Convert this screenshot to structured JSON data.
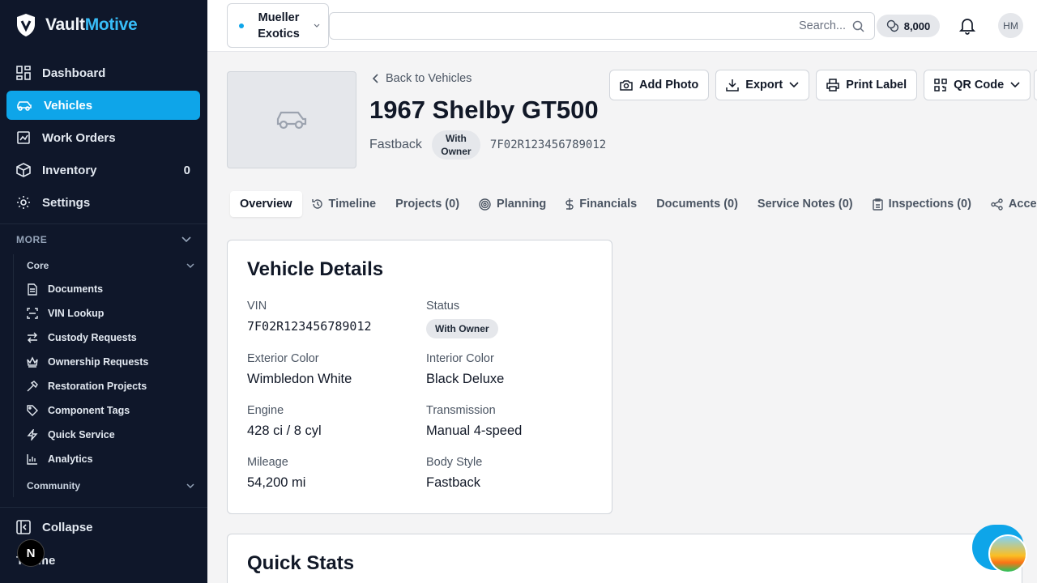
{
  "app": {
    "brand_part1": "Vault",
    "brand_part2": "Motive"
  },
  "sidebar": {
    "nav": [
      {
        "label": "Dashboard",
        "icon": "dashboard-icon"
      },
      {
        "label": "Vehicles",
        "icon": "car-icon",
        "active": true
      },
      {
        "label": "Work Orders",
        "icon": "clipboard-icon"
      },
      {
        "label": "Inventory",
        "icon": "box-icon",
        "count": "0"
      },
      {
        "label": "Settings",
        "icon": "gear-icon"
      }
    ],
    "more_label": "MORE",
    "core_label": "Core",
    "core_items": [
      {
        "label": "Documents",
        "icon": "document-icon"
      },
      {
        "label": "VIN Lookup",
        "icon": "scan-icon"
      },
      {
        "label": "Custody Requests",
        "icon": "swap-icon"
      },
      {
        "label": "Ownership Requests",
        "icon": "crown-icon"
      },
      {
        "label": "Restoration Projects",
        "icon": "hammer-icon"
      },
      {
        "label": "Component Tags",
        "icon": "tag-icon"
      },
      {
        "label": "Quick Service",
        "icon": "bolt-icon"
      },
      {
        "label": "Analytics",
        "icon": "bar-chart-icon"
      }
    ],
    "community_label": "Community",
    "collapse_label": "Collapse",
    "theme_label": "Theme",
    "n_badge": "N"
  },
  "topbar": {
    "org_name": "Mueller Exotics",
    "search_placeholder": "Search...",
    "credits": "8,000",
    "avatar_initials": "HM"
  },
  "vehicle": {
    "back_label": "Back to Vehicles",
    "title": "1967 Shelby GT500",
    "body_style": "Fastback",
    "status_badge": "With Owner",
    "vin": "7F02R123456789012"
  },
  "actions": {
    "add_photo": "Add Photo",
    "export": "Export",
    "print_label": "Print Label",
    "qr_code": "QR Code"
  },
  "tabs": [
    {
      "label": "Overview",
      "active": true
    },
    {
      "label": "Timeline",
      "icon": "history-icon"
    },
    {
      "label": "Projects (0)"
    },
    {
      "label": "Planning",
      "icon": "target-icon"
    },
    {
      "label": "Financials",
      "icon": "dollar-icon"
    },
    {
      "label": "Documents (0)"
    },
    {
      "label": "Service Notes (0)"
    },
    {
      "label": "Inspections (0)",
      "icon": "clipboard-check-icon"
    },
    {
      "label": "Access",
      "icon": "share-icon"
    }
  ],
  "details": {
    "title": "Vehicle Details",
    "vin_label": "VIN",
    "vin_value": "7F02R123456789012",
    "status_label": "Status",
    "status_value": "With Owner",
    "exterior_label": "Exterior Color",
    "exterior_value": "Wimbledon White",
    "interior_label": "Interior Color",
    "interior_value": "Black Deluxe",
    "engine_label": "Engine",
    "engine_value": "428 ci / 8 cyl",
    "transmission_label": "Transmission",
    "transmission_value": "Manual 4-speed",
    "mileage_label": "Mileage",
    "mileage_value": "54,200 mi",
    "bodystyle_label": "Body Style",
    "bodystyle_value": "Fastback"
  },
  "quick_stats": {
    "title": "Quick Stats"
  },
  "colors": {
    "accent": "#0ea5e9",
    "sidebar_bg": "#0f172a"
  }
}
